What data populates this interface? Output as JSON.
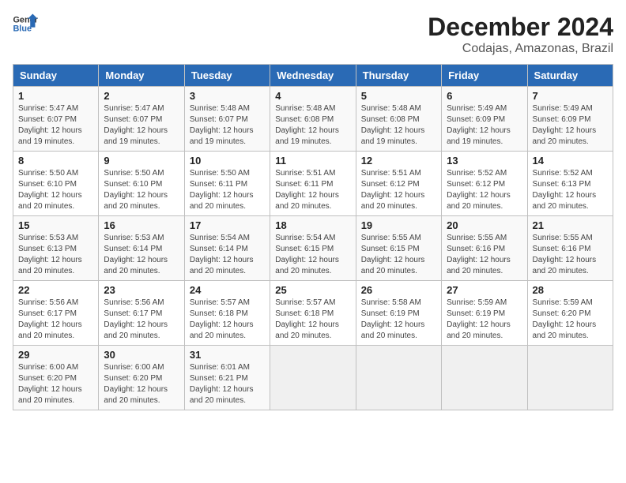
{
  "header": {
    "logo_line1": "General",
    "logo_line2": "Blue",
    "title": "December 2024",
    "subtitle": "Codajas, Amazonas, Brazil"
  },
  "weekdays": [
    "Sunday",
    "Monday",
    "Tuesday",
    "Wednesday",
    "Thursday",
    "Friday",
    "Saturday"
  ],
  "weeks": [
    [
      {
        "day": "1",
        "info": "Sunrise: 5:47 AM\nSunset: 6:07 PM\nDaylight: 12 hours\nand 19 minutes."
      },
      {
        "day": "2",
        "info": "Sunrise: 5:47 AM\nSunset: 6:07 PM\nDaylight: 12 hours\nand 19 minutes."
      },
      {
        "day": "3",
        "info": "Sunrise: 5:48 AM\nSunset: 6:07 PM\nDaylight: 12 hours\nand 19 minutes."
      },
      {
        "day": "4",
        "info": "Sunrise: 5:48 AM\nSunset: 6:08 PM\nDaylight: 12 hours\nand 19 minutes."
      },
      {
        "day": "5",
        "info": "Sunrise: 5:48 AM\nSunset: 6:08 PM\nDaylight: 12 hours\nand 19 minutes."
      },
      {
        "day": "6",
        "info": "Sunrise: 5:49 AM\nSunset: 6:09 PM\nDaylight: 12 hours\nand 19 minutes."
      },
      {
        "day": "7",
        "info": "Sunrise: 5:49 AM\nSunset: 6:09 PM\nDaylight: 12 hours\nand 20 minutes."
      }
    ],
    [
      {
        "day": "8",
        "info": "Sunrise: 5:50 AM\nSunset: 6:10 PM\nDaylight: 12 hours\nand 20 minutes."
      },
      {
        "day": "9",
        "info": "Sunrise: 5:50 AM\nSunset: 6:10 PM\nDaylight: 12 hours\nand 20 minutes."
      },
      {
        "day": "10",
        "info": "Sunrise: 5:50 AM\nSunset: 6:11 PM\nDaylight: 12 hours\nand 20 minutes."
      },
      {
        "day": "11",
        "info": "Sunrise: 5:51 AM\nSunset: 6:11 PM\nDaylight: 12 hours\nand 20 minutes."
      },
      {
        "day": "12",
        "info": "Sunrise: 5:51 AM\nSunset: 6:12 PM\nDaylight: 12 hours\nand 20 minutes."
      },
      {
        "day": "13",
        "info": "Sunrise: 5:52 AM\nSunset: 6:12 PM\nDaylight: 12 hours\nand 20 minutes."
      },
      {
        "day": "14",
        "info": "Sunrise: 5:52 AM\nSunset: 6:13 PM\nDaylight: 12 hours\nand 20 minutes."
      }
    ],
    [
      {
        "day": "15",
        "info": "Sunrise: 5:53 AM\nSunset: 6:13 PM\nDaylight: 12 hours\nand 20 minutes."
      },
      {
        "day": "16",
        "info": "Sunrise: 5:53 AM\nSunset: 6:14 PM\nDaylight: 12 hours\nand 20 minutes."
      },
      {
        "day": "17",
        "info": "Sunrise: 5:54 AM\nSunset: 6:14 PM\nDaylight: 12 hours\nand 20 minutes."
      },
      {
        "day": "18",
        "info": "Sunrise: 5:54 AM\nSunset: 6:15 PM\nDaylight: 12 hours\nand 20 minutes."
      },
      {
        "day": "19",
        "info": "Sunrise: 5:55 AM\nSunset: 6:15 PM\nDaylight: 12 hours\nand 20 minutes."
      },
      {
        "day": "20",
        "info": "Sunrise: 5:55 AM\nSunset: 6:16 PM\nDaylight: 12 hours\nand 20 minutes."
      },
      {
        "day": "21",
        "info": "Sunrise: 5:55 AM\nSunset: 6:16 PM\nDaylight: 12 hours\nand 20 minutes."
      }
    ],
    [
      {
        "day": "22",
        "info": "Sunrise: 5:56 AM\nSunset: 6:17 PM\nDaylight: 12 hours\nand 20 minutes."
      },
      {
        "day": "23",
        "info": "Sunrise: 5:56 AM\nSunset: 6:17 PM\nDaylight: 12 hours\nand 20 minutes."
      },
      {
        "day": "24",
        "info": "Sunrise: 5:57 AM\nSunset: 6:18 PM\nDaylight: 12 hours\nand 20 minutes."
      },
      {
        "day": "25",
        "info": "Sunrise: 5:57 AM\nSunset: 6:18 PM\nDaylight: 12 hours\nand 20 minutes."
      },
      {
        "day": "26",
        "info": "Sunrise: 5:58 AM\nSunset: 6:19 PM\nDaylight: 12 hours\nand 20 minutes."
      },
      {
        "day": "27",
        "info": "Sunrise: 5:59 AM\nSunset: 6:19 PM\nDaylight: 12 hours\nand 20 minutes."
      },
      {
        "day": "28",
        "info": "Sunrise: 5:59 AM\nSunset: 6:20 PM\nDaylight: 12 hours\nand 20 minutes."
      }
    ],
    [
      {
        "day": "29",
        "info": "Sunrise: 6:00 AM\nSunset: 6:20 PM\nDaylight: 12 hours\nand 20 minutes."
      },
      {
        "day": "30",
        "info": "Sunrise: 6:00 AM\nSunset: 6:20 PM\nDaylight: 12 hours\nand 20 minutes."
      },
      {
        "day": "31",
        "info": "Sunrise: 6:01 AM\nSunset: 6:21 PM\nDaylight: 12 hours\nand 20 minutes."
      },
      null,
      null,
      null,
      null
    ]
  ]
}
